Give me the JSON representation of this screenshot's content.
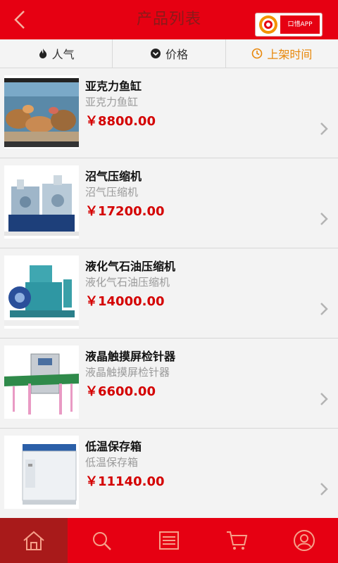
{
  "header": {
    "title": "产品列表",
    "app_badge": "口惜APP"
  },
  "sort": {
    "tabs": [
      {
        "label": "人气",
        "icon": "flame-icon"
      },
      {
        "label": "价格",
        "icon": "chevron-down-circle-icon"
      },
      {
        "label": "上架时间",
        "icon": "clock-icon",
        "active": true
      }
    ]
  },
  "products": [
    {
      "name": "亚克力鱼缸",
      "subtitle": "亚克力鱼缸",
      "price": "￥8800.00"
    },
    {
      "name": "沼气压缩机",
      "subtitle": "沼气压缩机",
      "price": "￥17200.00"
    },
    {
      "name": "液化气石油压缩机",
      "subtitle": "液化气石油压缩机",
      "price": "￥14000.00"
    },
    {
      "name": "液晶触摸屏检针器",
      "subtitle": "液晶触摸屏检针器",
      "price": "￥6600.00"
    },
    {
      "name": "低温保存箱",
      "subtitle": "低温保存箱",
      "price": "￥11140.00"
    }
  ],
  "tabbar": {
    "items": [
      "home-icon",
      "search-icon",
      "list-icon",
      "cart-icon",
      "user-icon"
    ],
    "active": "home-icon"
  },
  "colors": {
    "brand": "#e60012",
    "price": "#d40000",
    "active_sort": "#e8870a"
  }
}
